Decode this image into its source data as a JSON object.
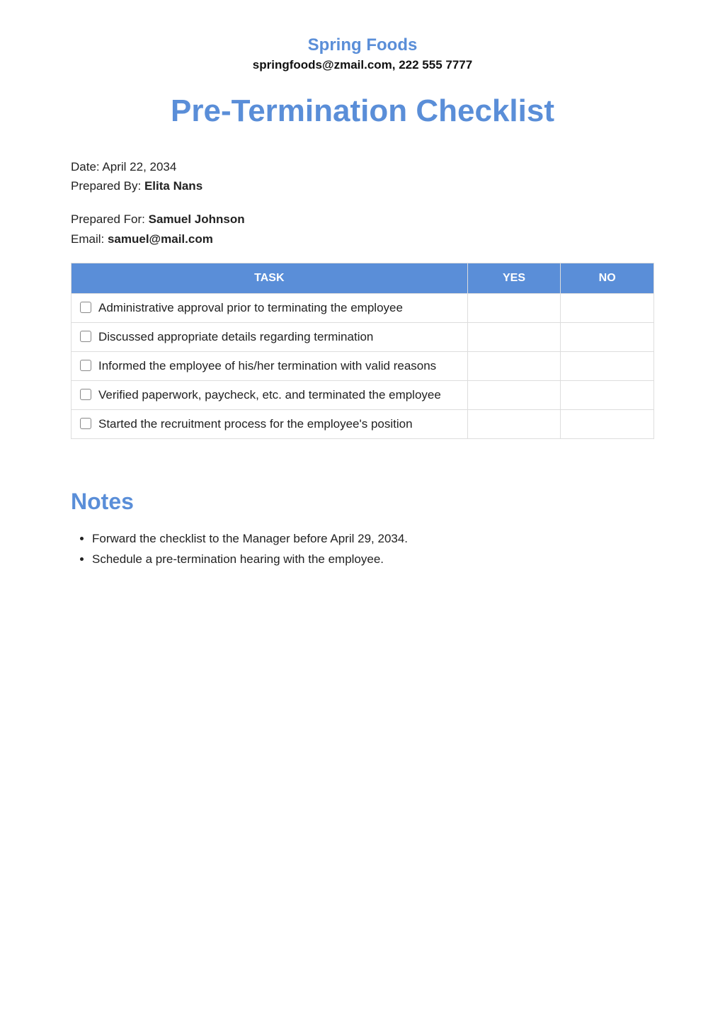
{
  "header": {
    "company": "Spring Foods",
    "contact": "springfoods@zmail.com, 222 555 7777"
  },
  "title": "Pre-Termination Checklist",
  "meta": {
    "date_label": "Date: ",
    "date_value": "April 22, 2034",
    "prepared_by_label": "Prepared By: ",
    "prepared_by_value": "Elita Nans",
    "prepared_for_label": "Prepared For: ",
    "prepared_for_value": "Samuel Johnson",
    "email_label": "Email: ",
    "email_value": "samuel@mail.com"
  },
  "table": {
    "headers": {
      "task": "TASK",
      "yes": "YES",
      "no": "NO"
    },
    "rows": [
      {
        "task": "Administrative approval prior to terminating the employee"
      },
      {
        "task": "Discussed appropriate details regarding termination"
      },
      {
        "task": "Informed the employee of his/her termination with valid reasons"
      },
      {
        "task": "Verified paperwork, paycheck, etc. and terminated the employee"
      },
      {
        "task": "Started the recruitment process for the employee's position"
      }
    ]
  },
  "notes": {
    "heading": "Notes",
    "items": [
      "Forward the checklist to the Manager before April 29, 2034.",
      "Schedule a pre-termination hearing with the employee."
    ]
  }
}
